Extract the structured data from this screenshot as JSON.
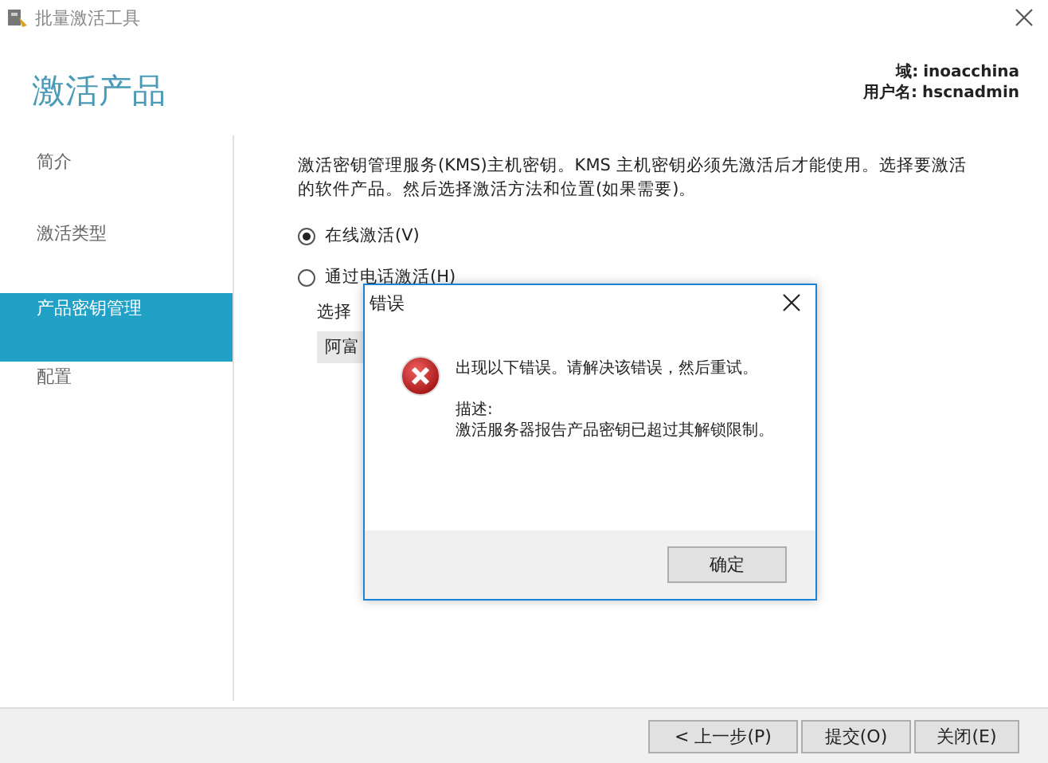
{
  "window": {
    "title": "批量激活工具"
  },
  "header": {
    "title": "激活产品",
    "domain_label": "域:",
    "domain": "inoacchina",
    "user_label": "用户名:",
    "user": "hscnadmin"
  },
  "sidebar": {
    "items": [
      {
        "label": "简介",
        "selected": false
      },
      {
        "label": "激活类型",
        "selected": false
      },
      {
        "label": "产品密钥管理",
        "selected": true
      },
      {
        "label": "配置",
        "selected": false
      }
    ]
  },
  "content": {
    "description": "激活密钥管理服务(KMS)主机密钥。KMS 主机密钥必须先激活后才能使用。选择要激活的软件产品。然后选择激活方法和位置(如果需要)。",
    "options": [
      {
        "label": "在线激活(V)",
        "selected": true
      },
      {
        "label": "通过电话激活(H)",
        "selected": false
      }
    ],
    "location_label": "选择",
    "location_value": "阿富"
  },
  "buttons": [
    "< 上一步(P)",
    "提交(O)",
    "关闭(E)"
  ],
  "dialog": {
    "title": "错误",
    "message": "出现以下错误。请解决该错误，然后重试。",
    "description_label": "描述:",
    "description": "激活服务器报告产品密钥已超过其解锁限制。",
    "button": "确定"
  }
}
